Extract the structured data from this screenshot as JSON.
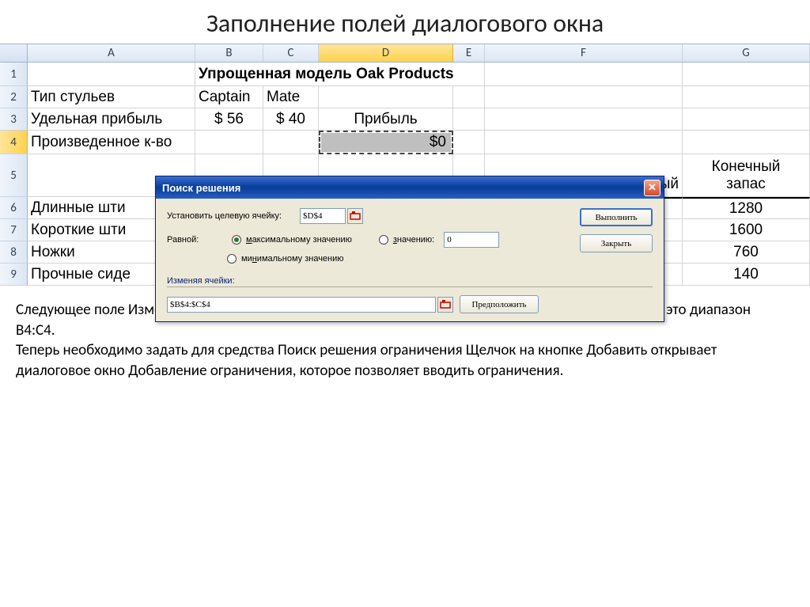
{
  "slide": {
    "title": "Заполнение полей диалогового окна"
  },
  "columns": [
    "A",
    "B",
    "C",
    "D",
    "E",
    "F",
    "G"
  ],
  "sheet": {
    "r1": {
      "title": "Упрощенная модель Oak Products"
    },
    "r2": {
      "a": "Тип стульев",
      "b": "Captain",
      "c": "Mate"
    },
    "r3": {
      "a": "Удельная прибыль",
      "b": "$ 56",
      "c": "$ 40",
      "d": "Прибыль"
    },
    "r4": {
      "a": "Произведенное к-во",
      "d": "$0"
    },
    "r5": {
      "f_suffix": "ый",
      "g1": "Конечный",
      "g2": "запас"
    },
    "r6": {
      "a": "Длинные шти",
      "g": "1280"
    },
    "r7": {
      "a": "Короткие шти",
      "g": "1600"
    },
    "r8": {
      "a": "Ножки",
      "g": "760"
    },
    "r9": {
      "a": "Прочные сиде",
      "g": "140"
    }
  },
  "dialog": {
    "title": "Поиск решения",
    "target_label": "Установить целевую ячейку:",
    "target_value": "$D$4",
    "equal_label": "Равной:",
    "opt_max": "максимальному значению",
    "opt_value": "значению:",
    "opt_min": "минимальному значению",
    "value_input": "0",
    "changing_label": "Изменяя ячейки:",
    "changing_value": "$B$4:$C$4",
    "btn_execute": "Выполнить",
    "btn_close": "Закрыть",
    "btn_suggest": "Предположить"
  },
  "body": "Следующее поле Изменяя ячейки позволяет указать переменные решения модели, в данном случае это диапазон B4:C4.\nТеперь необходимо задать для средства Поиск решения ограничения Щелчок на кнопке Добавить открывает диалоговое окно Добавление ограничения, которое позволяет вводить ограничения."
}
